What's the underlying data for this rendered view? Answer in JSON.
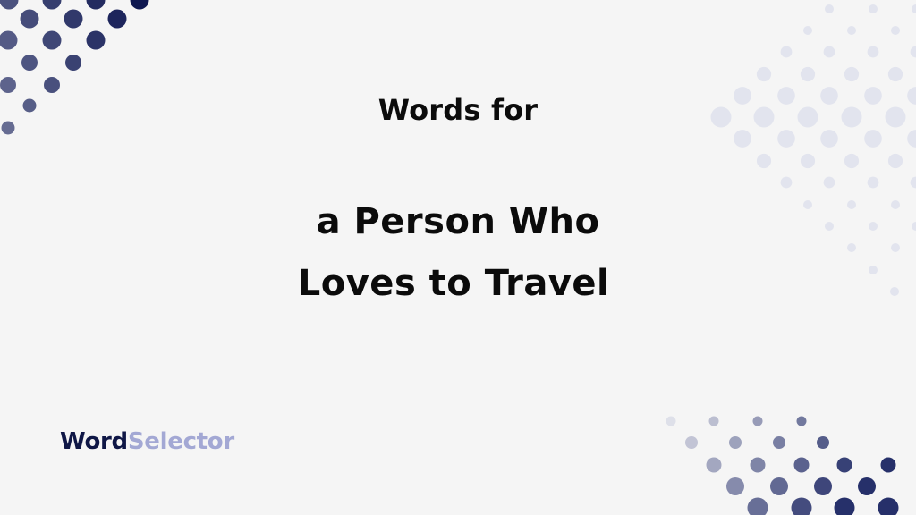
{
  "heading": {
    "prefix": "Words for",
    "line1": "a Person Who",
    "line2": "Loves to Travel"
  },
  "logo": {
    "part1": "Word",
    "part2": "Selector"
  },
  "colors": {
    "background": "#f5f5f5",
    "text": "#0b0b0b",
    "brand_dark": "#0f1746",
    "brand_light": "#a3a8d4",
    "dots_top_left": "#1e2a5e",
    "dots_top_right": "#e2e4ee",
    "dots_bottom_right": "#2b3670"
  },
  "decorations": {
    "top_left": "dot-pattern",
    "top_right": "dot-pattern",
    "bottom_right": "dot-pattern"
  }
}
